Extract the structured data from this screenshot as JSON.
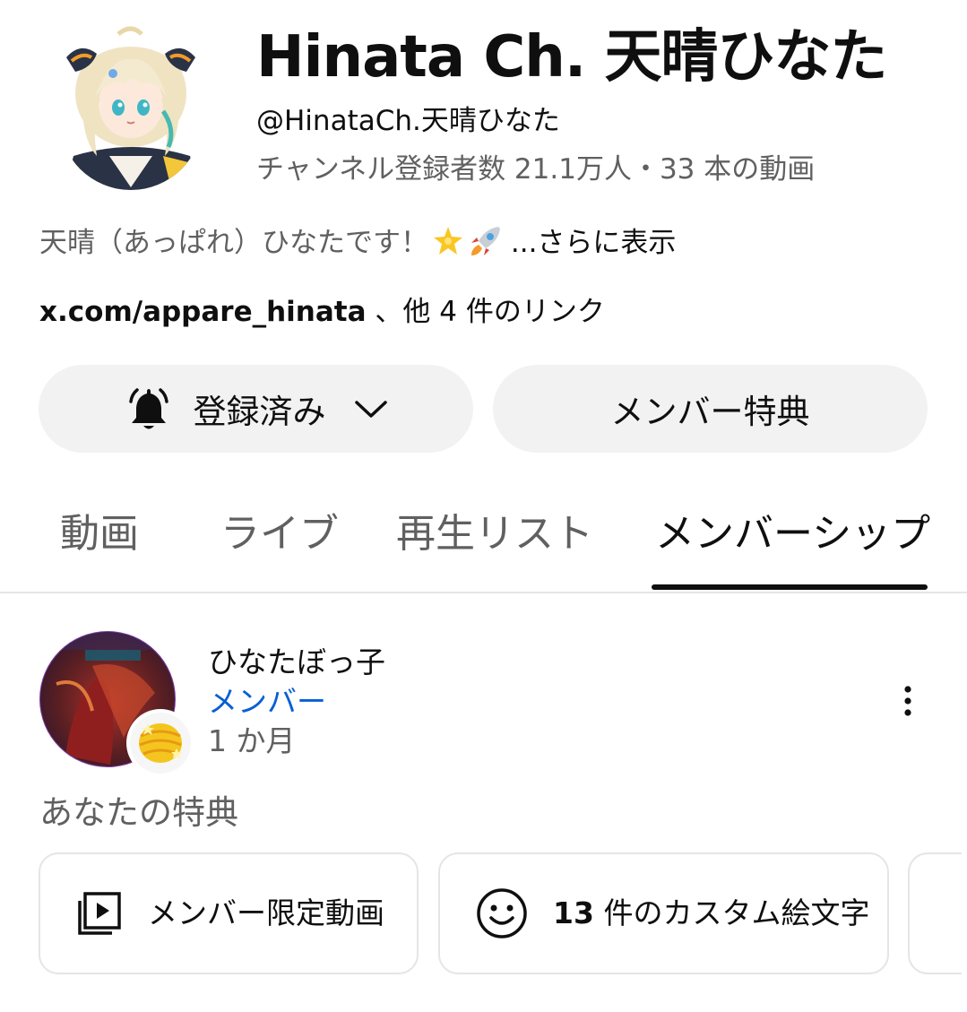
{
  "header": {
    "channel_name": "Hinata Ch. 天晴ひなた",
    "handle": "@HinataCh.天晴ひなた",
    "stats": "チャンネル登録者数 21.1万人・33 本の動画",
    "description": "天晴（あっぱれ）ひなたです！",
    "description_more": "...さらに表示",
    "link_url": "x.com/appare_hinata",
    "link_suffix": "、他 4 件のリンク"
  },
  "buttons": {
    "subscribed_label": "登録済み",
    "member_perks_label": "メンバー特典"
  },
  "tabs": [
    {
      "label": "動画",
      "active": false
    },
    {
      "label": "ライブ",
      "active": false
    },
    {
      "label": "再生リスト",
      "active": false
    },
    {
      "label": "メンバーシップ",
      "active": true
    }
  ],
  "membership": {
    "member_name": "ひなたぼっ子",
    "level": "メンバー",
    "duration": "1 か月",
    "perks_heading": "あなたの特典",
    "perks": [
      {
        "icon": "video-library-icon",
        "label": "メンバー限定動画"
      },
      {
        "icon": "smiley-icon",
        "count": "13",
        "label": "件のカスタム絵文字"
      }
    ]
  },
  "colors": {
    "accent_blue": "#065fd4",
    "pill_background": "#f2f2f2",
    "secondary_text": "#606060",
    "border": "#e5e5e5"
  }
}
